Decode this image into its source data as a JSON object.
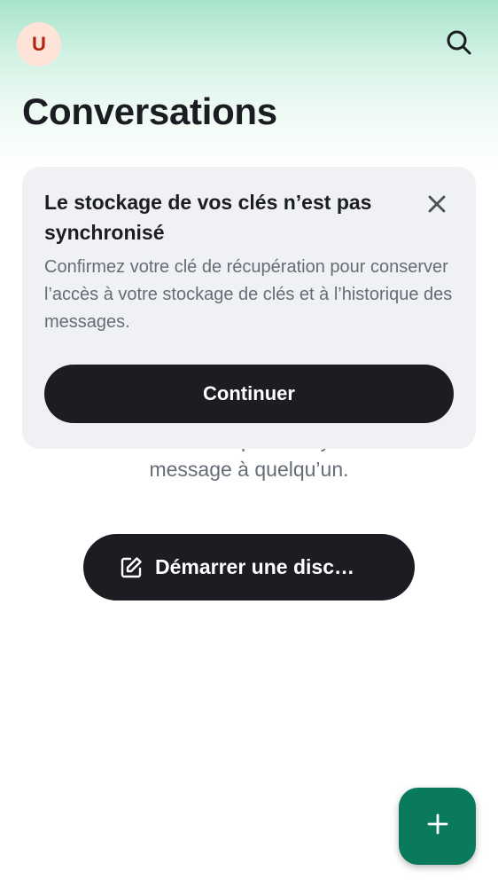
{
  "header": {
    "avatar_initial": "U",
    "search_icon": "search-icon",
    "title": "Conversations"
  },
  "banner": {
    "title": "Le stockage de vos clés n’est pas synchronisé",
    "body": "Confirmez votre clé de récupération pour conserver l’accès à votre stockage de clés et à l’historique des messages.",
    "close_icon": "close-icon",
    "continue_label": "Continuer"
  },
  "empty_state": {
    "line1": "Commencez par envoyer un",
    "line2": "message à quelqu’un.",
    "start_button_label": "Démarrer une disc…",
    "start_button_icon": "compose-icon"
  },
  "fab": {
    "icon": "plus-icon"
  },
  "colors": {
    "accent": "#0a7a5c",
    "dark_button": "#1b1d22",
    "banner_bg": "#eff1f4",
    "avatar_bg": "#fde3d8",
    "avatar_text": "#b5230e"
  }
}
